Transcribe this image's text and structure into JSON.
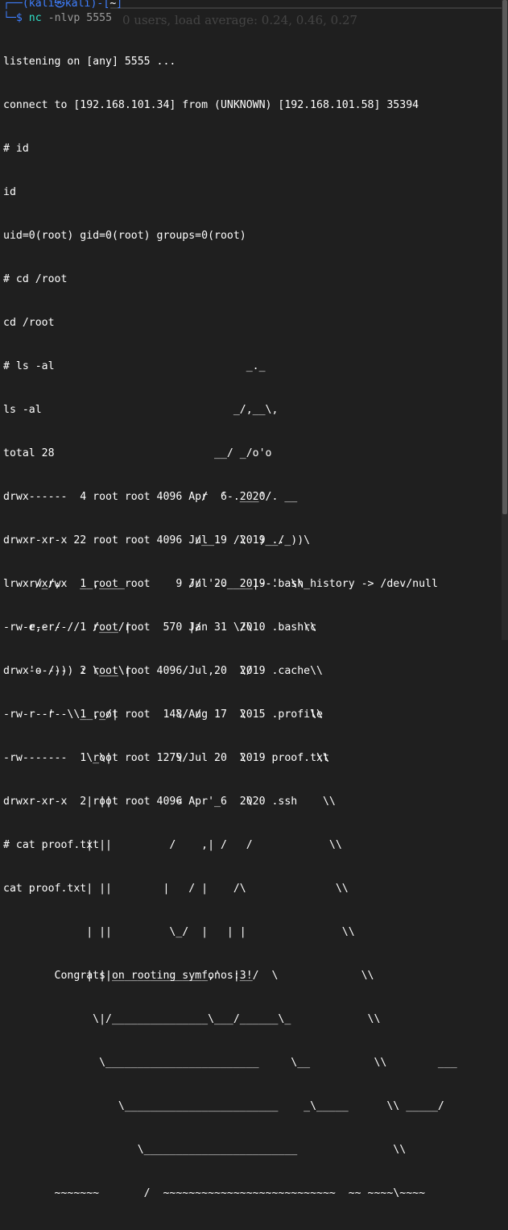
{
  "terminal": {
    "background_title": "0 users, load average: 0.24, 0.46, 0.27",
    "prompt": {
      "corner_top": "┌──",
      "user_host": "(kali㉿kali)",
      "path_open": "-[",
      "path": "~",
      "path_close": "]",
      "corner_bottom": "└─",
      "symbol": "$",
      "command_name": "nc",
      "command_args": "-nlvp 5555"
    },
    "lines": [
      "listening on [any] 5555 ...",
      "connect to [192.168.101.34] from (UNKNOWN) [192.168.101.58] 35394",
      "# id",
      "id",
      "uid=0(root) gid=0(root) groups=0(root)",
      "# cd /root",
      "cd /root",
      "# ls -al",
      "ls -al",
      "total 28",
      "drwx------  4 root root 4096 Apr  6  2020 .",
      "drwxr-xr-x 22 root root 4096 Jul 19  2019 ..",
      "lrwxrwxrwx  1 root root    9 Jul 20  2019 .bash_history -> /dev/null",
      "-rw-r--r--  1 root root  570 Jan 31  2010 .bashrc",
      "drwx------  2 root root 4096 Jul 20  2019 .cache",
      "-rw-r--r--  1 root root  148 Aug 17  2015 .profile",
      "-rw-------  1 root root 1279 Jul 20  2019 proof.txt",
      "drwxr-xr-x  2 root root 4096 Apr  6  2020 .ssh",
      "# cat proof.txt",
      "cat proof.txt",
      "",
      "        Congrats on rooting symfonos:3!"
    ],
    "art_lines": [
      "                                      _._",
      "                                    _/,__\\,",
      "                                 __/ _/o'o",
      "                               /  '-.___'/  __",
      "                              /__   /\\  )__/_))\\",
      "     /_/,   __,____          // '-.____|--'  \\\\",
      "    e,e / //  /___/|         |/     \\/\\        \\\\",
      "    'o /))) : \\___\\|        /   ,    \\/         \\\\",
      "      -'  \\\\__,_/|         \\/ /      \\          \\\\",
      "             \\_\\|          \\/        \\           \\\\",
      "             | ||          <    '_    \\           \\\\",
      "             | ||         /    ,| /   /            \\\\",
      "             | ||        |   / |    /\\              \\\\",
      "             | ||         \\_/  |   | |               \\\\",
      "             | ||_______________,'  |__/  \\             \\\\",
      "              \\|/_______________\\___/______\\_            \\\\",
      "               \\________________________     \\__          \\\\        ___",
      "                  \\________________________    _\\_____      \\\\ _____/",
      "                     \\________________________               \\\\",
      "        ~~~~~~~       /  ~~~~~~~~~~~~~~~~~~~~~~~~~~~  ~~ ~~~~\\~~~~"
    ]
  }
}
